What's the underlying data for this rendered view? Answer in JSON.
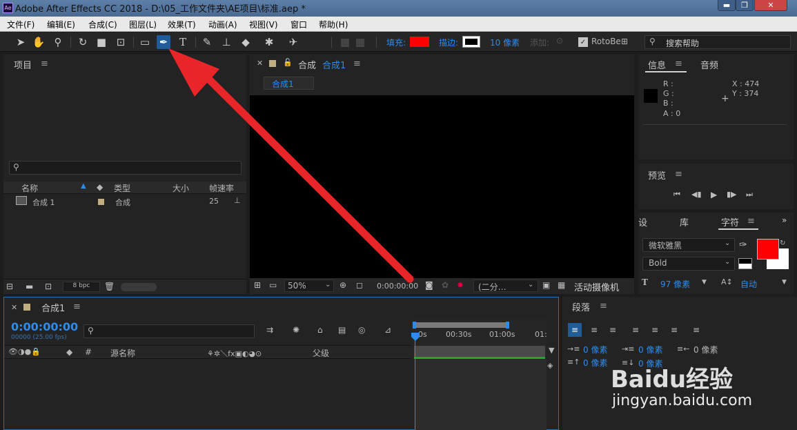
{
  "window": {
    "title": "Adobe After Effects CC 2018 - D:\\05_工作文件夹\\AE项目\\标准.aep *",
    "min": "▬",
    "max": "❐",
    "close": "✕"
  },
  "menu": [
    "文件(F)",
    "编辑(E)",
    "合成(C)",
    "图层(L)",
    "效果(T)",
    "动画(A)",
    "视图(V)",
    "窗口",
    "帮助(H)"
  ],
  "toolbar": {
    "fill_label": "填充:",
    "stroke_label": "描边:",
    "stroke_width": "10 像素",
    "add_label": "添加:",
    "roto_label": "RotoBe",
    "search_placeholder": "搜索帮助",
    "fill_color": "#ff0000",
    "stroke_color": "#ffffff"
  },
  "project": {
    "title": "项目",
    "columns": [
      "名称",
      "类型",
      "大小",
      "帧速率"
    ],
    "items": [
      {
        "name": "合成 1",
        "type": "合成",
        "fps": "25"
      }
    ],
    "bpc": "8 bpc"
  },
  "composition": {
    "header": "合成",
    "comp_name": "合成1",
    "tab": "合成1",
    "zoom": "50%",
    "timecode": "0:00:00:00",
    "resolution": "(二分…",
    "camera": "活动摄像机"
  },
  "info": {
    "tab_info": "信息",
    "tab_audio": "音频",
    "r": "R :",
    "g": "G :",
    "b": "B :",
    "a": "A : 0",
    "x": "X : 474",
    "y": "Y : 374"
  },
  "preview": {
    "title": "预览"
  },
  "character": {
    "tab_effects": "设",
    "tab_library": "库",
    "tab_char": "字符",
    "font": "微软雅黑",
    "style": "Bold",
    "size": "97 像素",
    "leading": "自动",
    "fill_color": "#ff0000"
  },
  "timeline": {
    "title": "合成1",
    "timecode": "0:00:00:00",
    "frames": "00000 (25.00 fps)",
    "col_source": "源名称",
    "col_parent": "父级",
    "col_hash": "#",
    "ruler": [
      "0s",
      "00:30s",
      "01:00s",
      "01:"
    ]
  },
  "paragraph": {
    "title": "段落",
    "indent_left": "0 像素",
    "indent_first": "0 像素",
    "indent_right": "0 像素",
    "space_before": "0 像素",
    "space_after": "0 像素"
  },
  "watermark": {
    "brand": "Baidu经验",
    "url": "jingyan.baidu.com"
  },
  "annotation_color": "#e8262a"
}
